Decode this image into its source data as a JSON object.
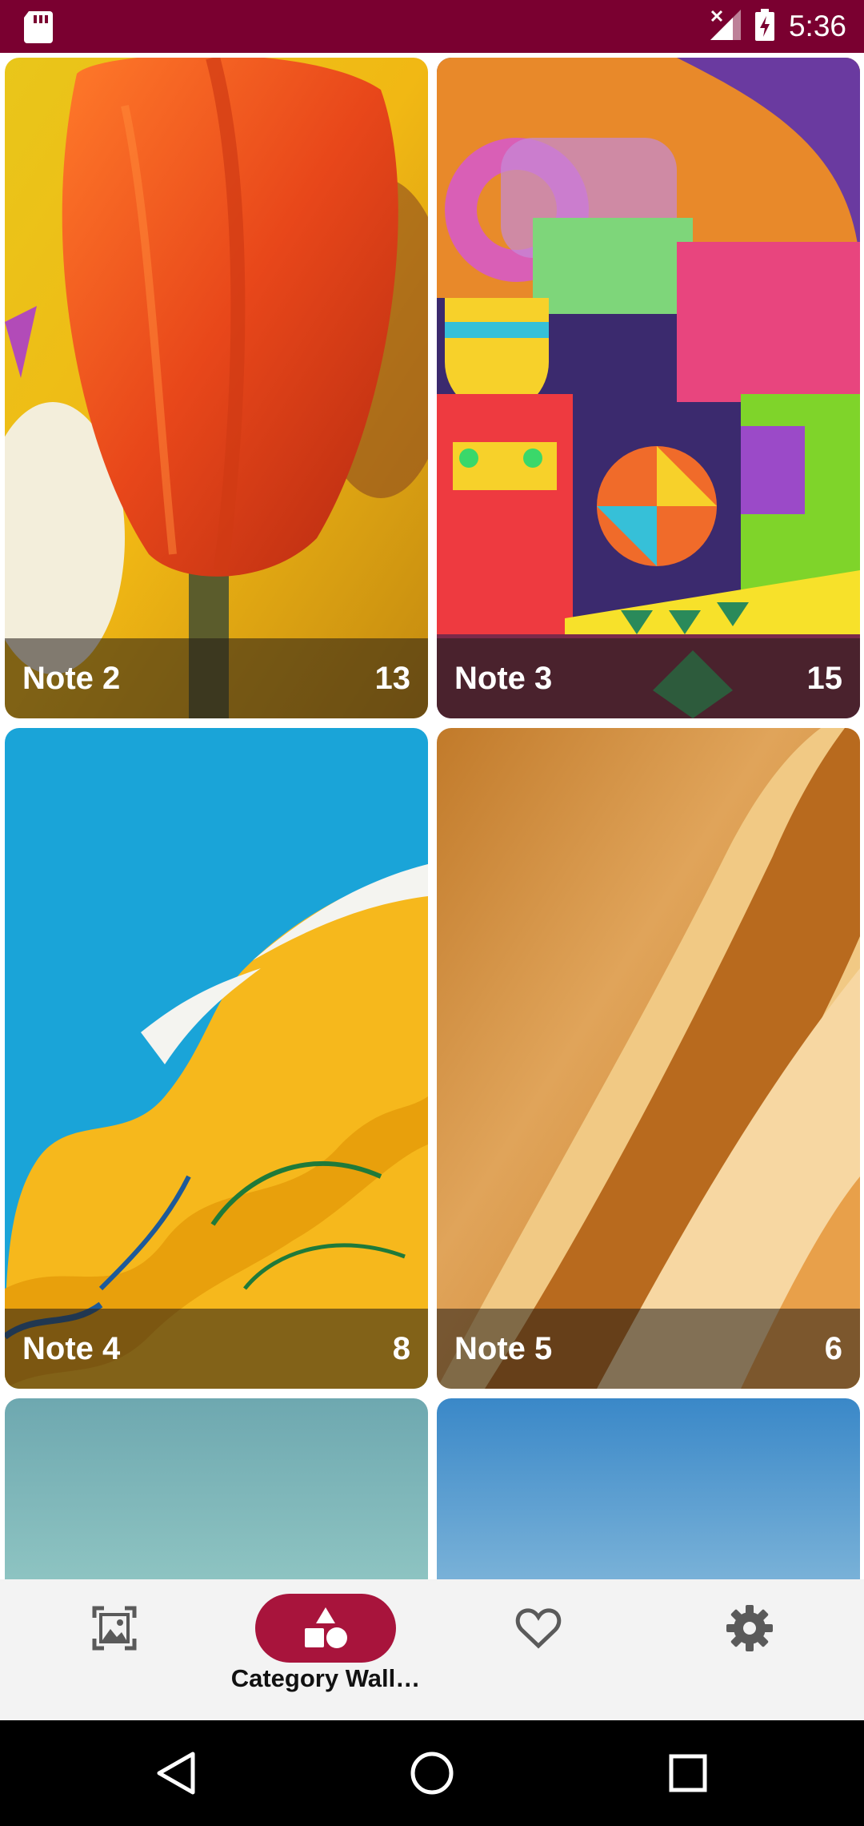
{
  "status_bar": {
    "time": "5:36",
    "icons": [
      "sd-card-icon",
      "no-signal-icon",
      "battery-charging-icon"
    ]
  },
  "grid": {
    "cards": [
      {
        "title": "Note 2",
        "count": "13"
      },
      {
        "title": "Note 3",
        "count": "15"
      },
      {
        "title": "Note 4",
        "count": "8"
      },
      {
        "title": "Note 5",
        "count": "6"
      },
      {
        "title": "",
        "count": ""
      },
      {
        "title": "",
        "count": ""
      }
    ]
  },
  "bottom_nav": {
    "items": [
      {
        "icon": "wallpaper-icon",
        "label": ""
      },
      {
        "icon": "category-shapes-icon",
        "label": "Category Wall…",
        "active": true
      },
      {
        "icon": "heart-icon",
        "label": ""
      },
      {
        "icon": "gear-icon",
        "label": ""
      }
    ]
  },
  "system_nav": {
    "icons": [
      "back-icon",
      "home-icon",
      "recents-icon"
    ]
  },
  "colors": {
    "status_bar": "#7a0030",
    "accent": "#a8143c",
    "nav_background": "#f3f3f3"
  }
}
